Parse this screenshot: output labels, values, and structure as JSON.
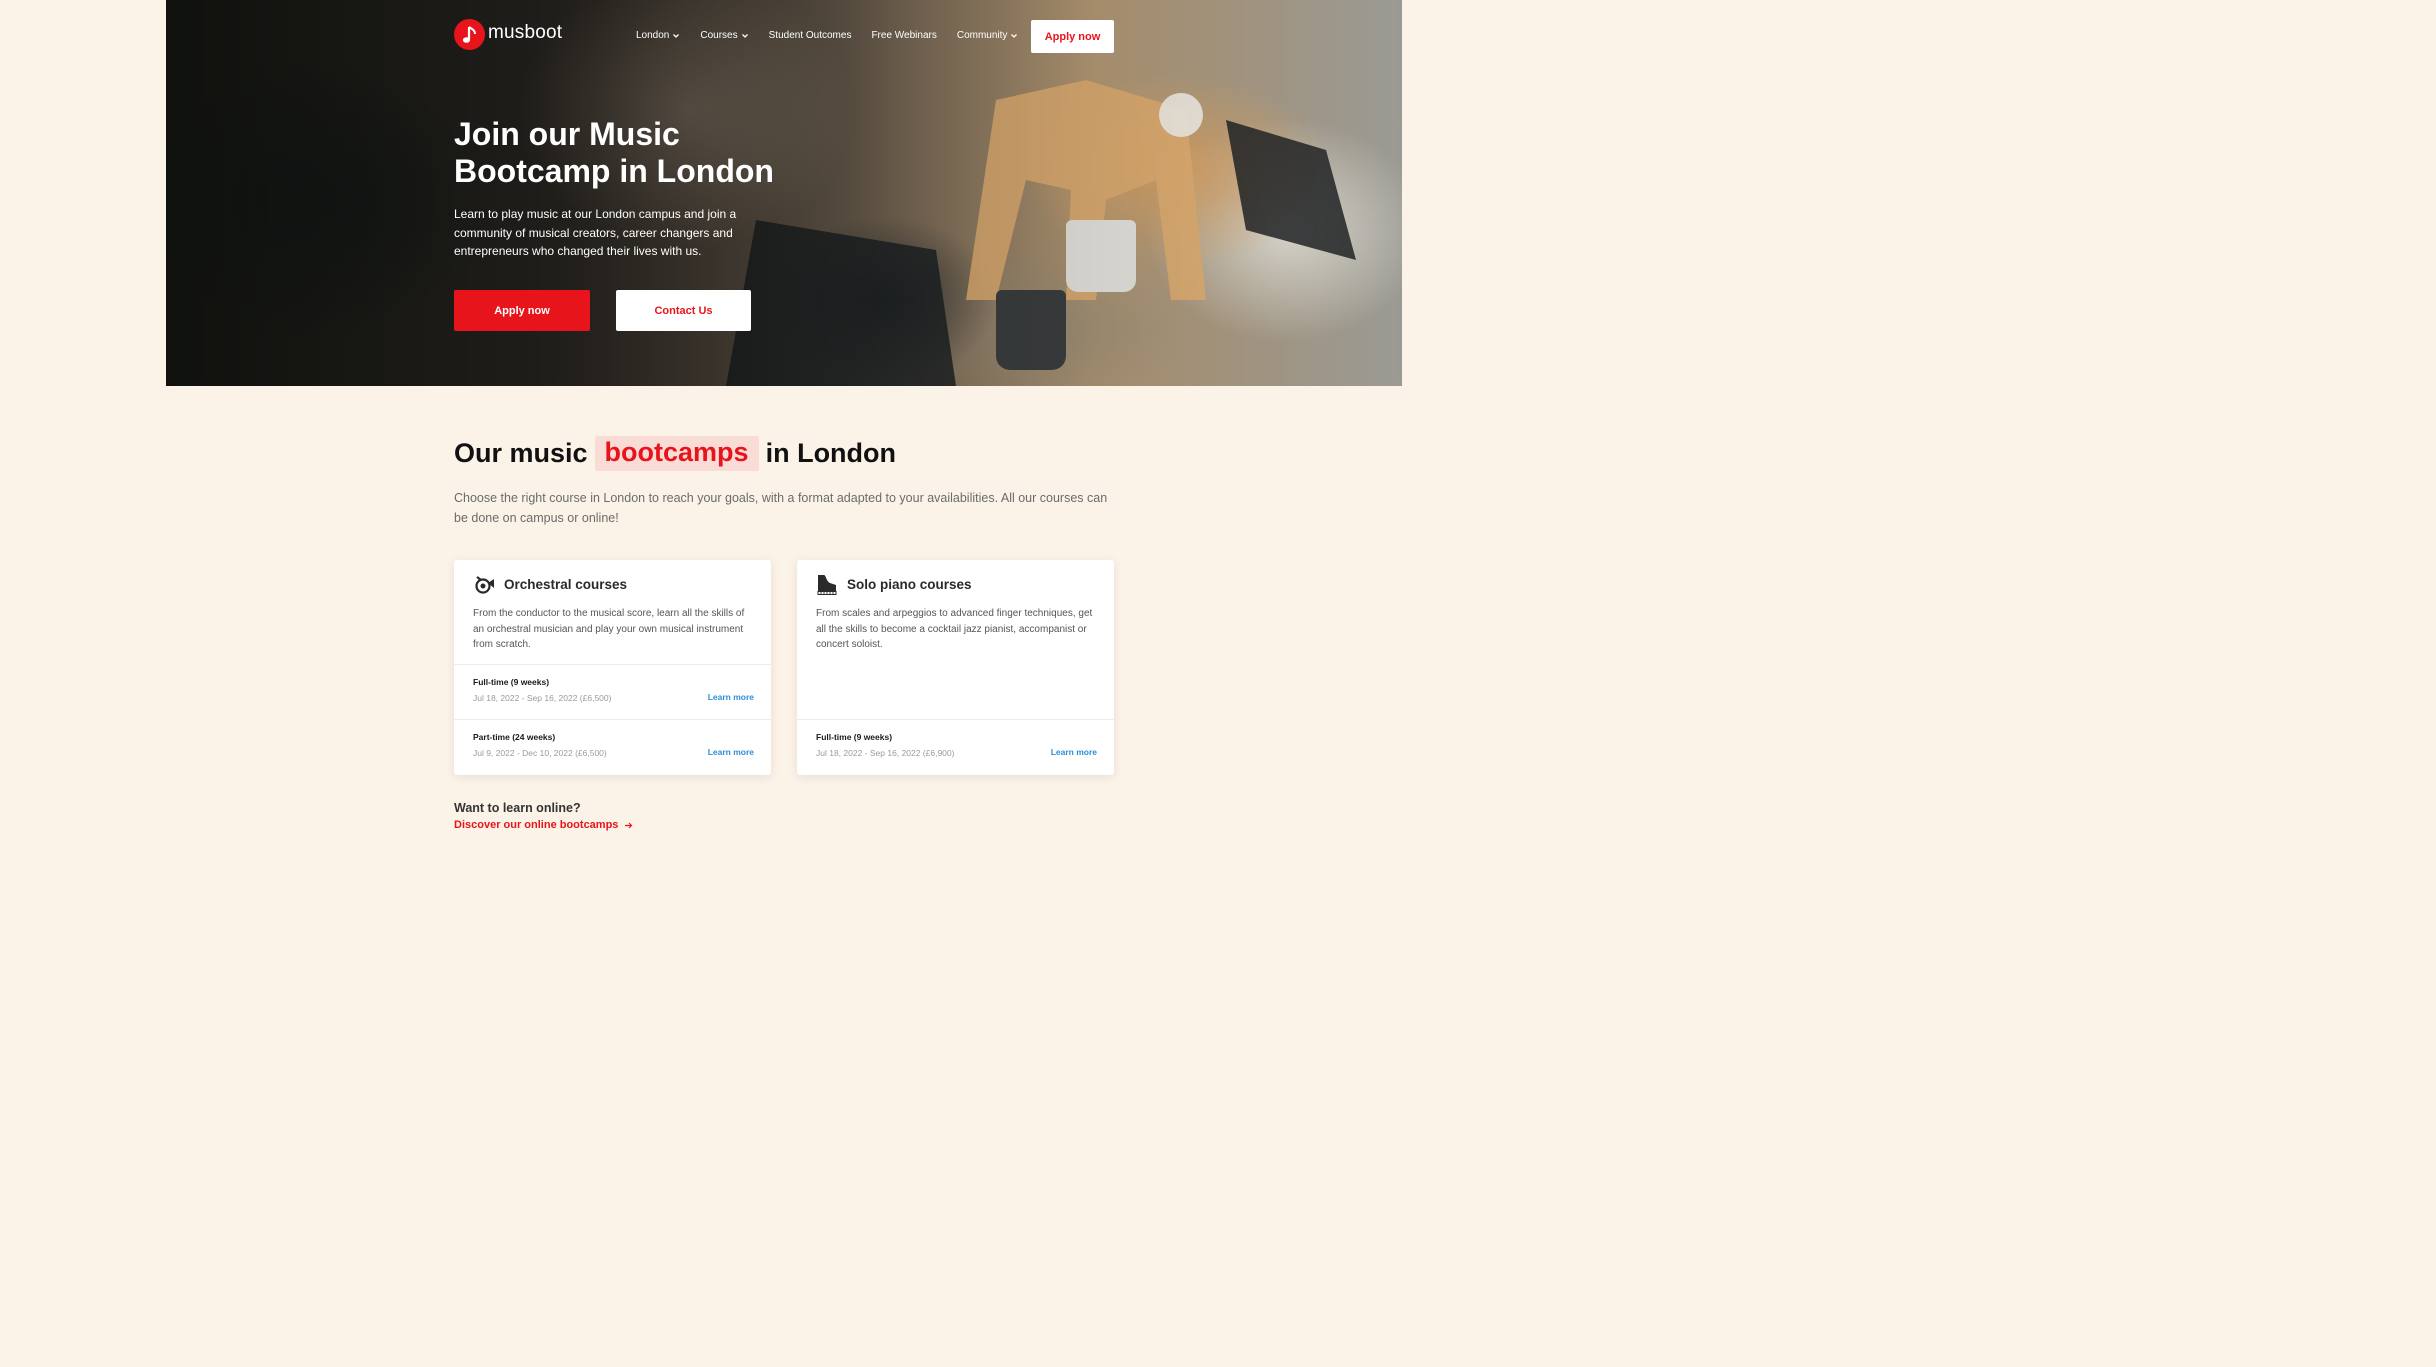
{
  "brand": {
    "name": "musboot",
    "accent": "#e8141c"
  },
  "nav": {
    "items": [
      {
        "label": "London",
        "dropdown": true
      },
      {
        "label": "Courses",
        "dropdown": true
      },
      {
        "label": "Student Outcomes",
        "dropdown": false
      },
      {
        "label": "Free Webinars",
        "dropdown": false
      },
      {
        "label": "Community",
        "dropdown": true
      }
    ],
    "apply_label": "Apply now"
  },
  "hero": {
    "title": "Join our Music Bootcamp in London",
    "subtitle": "Learn to play music at our London campus and join a community of musical creators, career changers and entrepreneurs who changed their lives with us.",
    "apply_label": "Apply now",
    "contact_label": "Contact Us"
  },
  "section": {
    "title_before": "Our music",
    "title_highlight": "bootcamps",
    "title_after": "in London",
    "description": "Choose the right course in London to reach your goals, with a format adapted to your availabilities. All our courses can be done on campus or online!"
  },
  "courses": [
    {
      "icon": "horn-icon",
      "title": "Orchestral courses",
      "description": "From the conductor to the musical score, learn all the skills of an orchestral musician and play your own musical instrument from scratch.",
      "sessions": [
        {
          "name": "Full-time (9 weeks)",
          "dates": "Jul 18, 2022 - Sep 16, 2022 (£6,500)",
          "link": "Learn more"
        },
        {
          "name": "Part-time (24 weeks)",
          "dates": "Jul 9, 2022 - Dec 10, 2022 (£6,500)",
          "link": "Learn more"
        }
      ]
    },
    {
      "icon": "piano-icon",
      "title": "Solo piano courses",
      "description": "From scales and arpeggios to advanced finger techniques, get all the skills to become a cocktail jazz pianist, accompanist or concert soloist.",
      "sessions": [
        {
          "name": "Full-time (9 weeks)",
          "dates": "Jul 18, 2022 - Sep 16, 2022 (£6,900)",
          "link": "Learn more"
        }
      ]
    }
  ],
  "online": {
    "question": "Want to learn online?",
    "link": "Discover our online bootcamps"
  }
}
